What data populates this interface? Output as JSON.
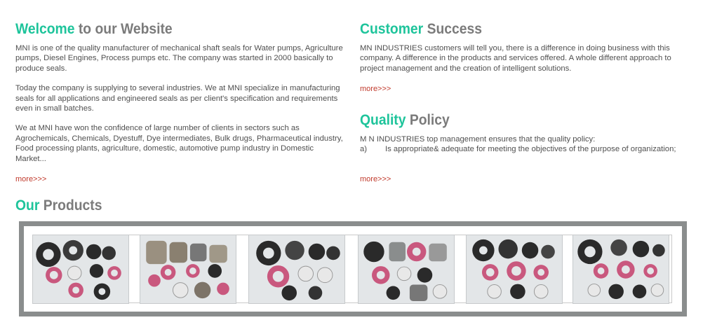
{
  "welcome": {
    "title_accent": "Welcome",
    "title_rest": "to our Website",
    "para1": "MNI is one of the quality manufacturer of mechanical shaft seals for Water pumps, Agriculture pumps, Diesel Engines, Process pumps etc. The company was started in 2000 basically to produce seals.",
    "para2": "Today the company is supplying to several industries. We at MNI specialize in manufacturing seals for all applications and engineered seals as per client's specification and requirements even in small batches.",
    "para3": "We at MNI have won the confidence of large number of clients in sectors such as Agrochemicals, Chemicals, Dyestuff, Dye intermediates, Bulk drugs, Pharmaceutical industry, Food processing plants, agriculture, domestic, automotive pump industry in Domestic Market...",
    "more": "more>>>"
  },
  "customer": {
    "title_accent": "Customer",
    "title_rest": "Success",
    "para": "MN INDUSTRIES customers will tell you, there is a difference in doing business with this company. A difference in the products and services offered. A whole different approach to project management and the creation of intelligent solutions.",
    "more": "more>>>"
  },
  "quality": {
    "title_accent": "Quality",
    "title_rest": "Policy",
    "line1": "M N INDUSTRIES top management ensures that the quality policy:",
    "item_label": "a)",
    "item_text": "Is appropriate& adequate for meeting the objectives of the  purpose of organization;",
    "more": "more>>>"
  },
  "products": {
    "title_accent": "Our",
    "title_rest": "Products",
    "images": [
      {
        "icon": "seal-product-image-1"
      },
      {
        "icon": "seal-product-image-2"
      },
      {
        "icon": "seal-product-image-3"
      },
      {
        "icon": "seal-product-image-4"
      },
      {
        "icon": "seal-product-image-5"
      },
      {
        "icon": "seal-product-image-6"
      }
    ]
  },
  "colors": {
    "accent": "#1ec49b",
    "heading_gray": "#7b7b7b",
    "link": "#c0392b",
    "frame": "#8a8d8d",
    "seal_pink": "#c9587e",
    "seal_black": "#2a2a2a",
    "seal_white": "#e8e8e8"
  }
}
